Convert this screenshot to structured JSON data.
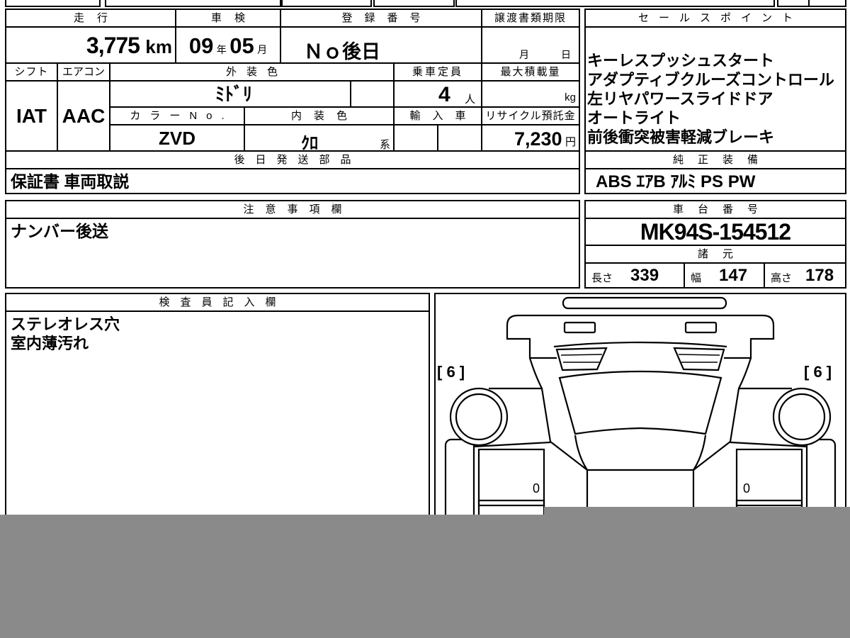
{
  "vehicle": {
    "mileage_header": "走行",
    "mileage": "3,775",
    "mileage_unit": "km",
    "inspection_header": "車検",
    "inspection_year": "09",
    "inspection_year_unit": "年",
    "inspection_month": "05",
    "inspection_month_unit": "月",
    "registration_header": "登録番号",
    "registration_number": "Ｎｏ後日",
    "transfer_deadline_header": "譲渡書類期限",
    "transfer_month_unit": "月",
    "transfer_day_unit": "日",
    "shift_header": "シフト",
    "shift": "IAT",
    "aircon_header": "エアコン",
    "aircon": "AAC",
    "exterior_color_header": "外装色",
    "exterior_color": "ﾐﾄﾞﾘ",
    "capacity_header": "乗車定員",
    "capacity": "4",
    "capacity_unit": "人",
    "max_load_header": "最大積載量",
    "max_load_unit": "kg",
    "color_no_header": "カラーNo.",
    "color_no": "ZVD",
    "interior_color_header": "内装色",
    "interior_color": "ｸﾛ",
    "interior_color_suffix": "系",
    "import_header": "輸入車",
    "recycle_fee_header": "リサイクル預託金",
    "recycle_fee": "7,230",
    "recycle_fee_unit": "円"
  },
  "later_parts": {
    "header": "後日発送部品",
    "value": "保証書 車両取説"
  },
  "sales_points": {
    "header": "セールスポイント",
    "items": [
      "キーレスプッシュスタート",
      "アダプティブクルーズコントロール",
      "左リヤパワースライドドア",
      "オートライト",
      "前後衝突被害軽減ブレーキ"
    ]
  },
  "genuine_equipment": {
    "header": "純正装備",
    "value": "ABS ｴｱB ｱﾙﾐ PS PW"
  },
  "notes": {
    "header": "注意事項欄",
    "value": "ナンバー後送"
  },
  "chassis": {
    "header": "車台番号",
    "value": "MK94S-154512"
  },
  "specs": {
    "header": "諸元",
    "length_label": "長さ",
    "length": "339",
    "width_label": "幅",
    "width": "147",
    "height_label": "高さ",
    "height": "178"
  },
  "inspector": {
    "header": "検査員記入欄",
    "lines": [
      "ステレオレス穴",
      "室内薄汚れ"
    ]
  },
  "diagram": {
    "left_marker": "[ 6 ]",
    "right_marker": "[ 6 ]",
    "left_door_mark": "0",
    "right_door_mark": "0"
  },
  "colors": {
    "ink": "#000000",
    "paper": "#ffffff",
    "redaction": "#8a8a8a"
  }
}
